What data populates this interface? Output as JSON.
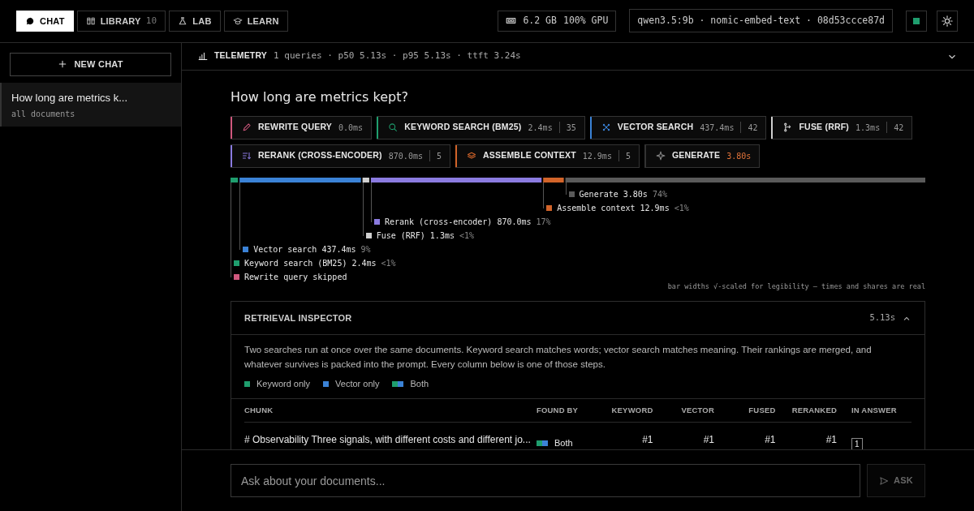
{
  "tabs": [
    {
      "label": "CHAT",
      "selected": true
    },
    {
      "label": "LIBRARY",
      "count": "10",
      "selected": false
    },
    {
      "label": "LAB",
      "selected": false
    },
    {
      "label": "LEARN",
      "selected": false
    }
  ],
  "gpu": {
    "memory": "6.2 GB",
    "usage": "100% GPU"
  },
  "models": "qwen3.5:9b · nomic-embed-text · 08d53ccce87d",
  "status": {
    "color": "#1f9e6e"
  },
  "sidebar": {
    "new_chat": "NEW CHAT",
    "items": [
      {
        "title": "How long are metrics k...",
        "scope": "all documents",
        "selected": true
      }
    ]
  },
  "telemetry": {
    "label": "TELEMETRY",
    "summary": "1 queries · p50 5.13s · p95 5.13s · ttft 3.24s",
    "expanded": false
  },
  "question": "How long are metrics kept?",
  "steps": [
    {
      "label": "REWRITE QUERY",
      "time": "0.0ms",
      "color": "#d0587e",
      "accent": true,
      "time_highlight": false
    },
    {
      "label": "KEYWORD SEARCH (BM25)",
      "time": "2.4ms",
      "count": "35",
      "color": "#1f9e6e",
      "accent": true,
      "time_highlight": false
    },
    {
      "label": "VECTOR SEARCH",
      "time": "437.4ms",
      "count": "42",
      "color": "#3b82d6",
      "accent": true,
      "time_highlight": false
    },
    {
      "label": "FUSE (RRF)",
      "time": "1.3ms",
      "count": "42",
      "color": "#d0d0d0",
      "accent": true,
      "time_highlight": false
    },
    {
      "label": "RERANK (CROSS-ENCODER)",
      "time": "870.0ms",
      "count": "5",
      "color": "#8b7be0",
      "accent": true,
      "time_highlight": false
    },
    {
      "label": "ASSEMBLE CONTEXT",
      "time": "12.9ms",
      "count": "5",
      "color": "#d2642a",
      "accent": true,
      "time_highlight": false
    },
    {
      "label": "GENERATE",
      "time": "3.80s",
      "accent": false,
      "time_highlight": true
    }
  ],
  "timeline": [
    {
      "name": "Generate",
      "time": "3.80s",
      "share": "74%",
      "color": "#5a5a5a"
    },
    {
      "name": "Assemble context",
      "time": "12.9ms",
      "share": "<1%",
      "color": "#d2642a"
    },
    {
      "name": "Rerank (cross-encoder)",
      "time": "870.0ms",
      "share": "17%",
      "color": "#8b7be0"
    },
    {
      "name": "Fuse (RRF)",
      "time": "1.3ms",
      "share": "<1%",
      "color": "#d0d0d0"
    },
    {
      "name": "Vector search",
      "time": "437.4ms",
      "share": "9%",
      "color": "#3b82d6"
    },
    {
      "name": "Keyword search (BM25)",
      "time": "2.4ms",
      "share": "<1%",
      "color": "#1f9e6e"
    },
    {
      "name": "Rewrite query",
      "time": "skipped",
      "color": "#d0587e"
    }
  ],
  "timeline_note": "bar widths √-scaled for legibility — times and shares are real",
  "inspector": {
    "title": "RETRIEVAL INSPECTOR",
    "total": "5.13s",
    "expanded": true,
    "description": "Two searches run at once over the same documents. Keyword search matches words; vector search matches meaning. Their rankings are merged, and whatever survives is packed into the prompt. Every column below is one of those steps.",
    "legend": [
      {
        "label": "Keyword only",
        "kind": "single",
        "color": "#1f9e6e"
      },
      {
        "label": "Vector only",
        "kind": "single",
        "color": "#3b82d6"
      },
      {
        "label": "Both",
        "kind": "pair"
      }
    ],
    "columns": [
      "CHUNK",
      "FOUND BY",
      "KEYWORD",
      "VECTOR",
      "FUSED",
      "RERANKED",
      "IN ANSWER"
    ],
    "rows": [
      {
        "chunk": "# Observability Three signals, with different costs and different jo...",
        "found_by": "Both",
        "kind": "pair",
        "keyword": "#1",
        "vector": "#1",
        "fused": "#1",
        "reranked": "#1",
        "in_answer": "1"
      }
    ]
  },
  "composer": {
    "placeholder": "Ask about your documents...",
    "button": "ASK",
    "disabled": true
  }
}
